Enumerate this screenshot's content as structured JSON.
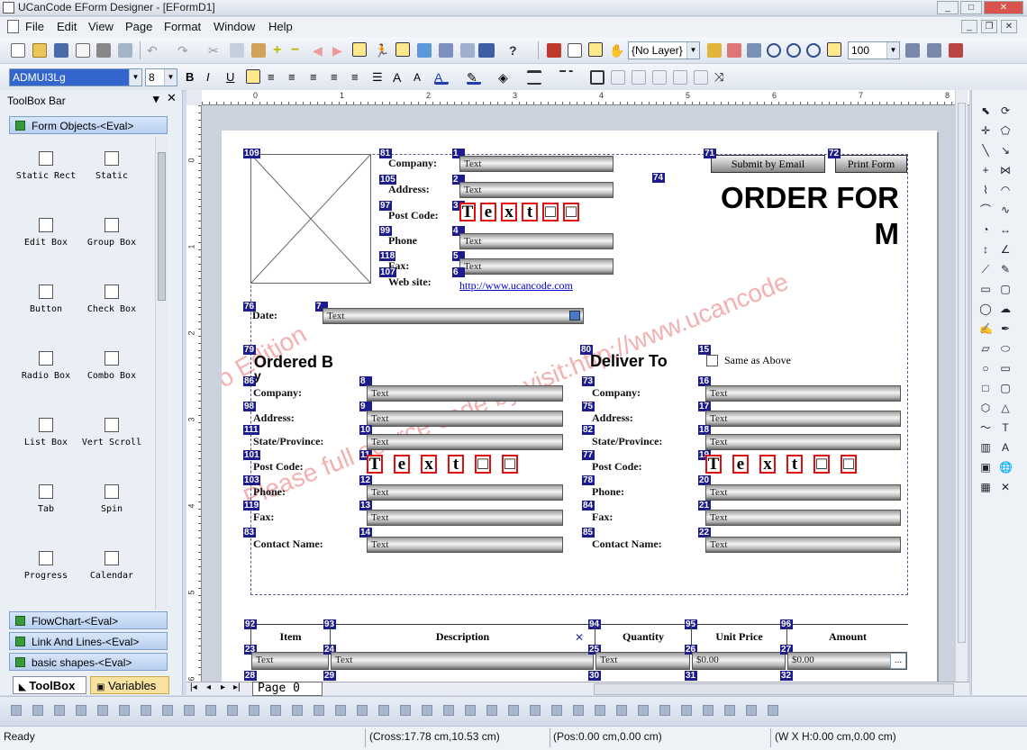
{
  "window": {
    "title": "UCanCode EForm Designer - [EFormD1]"
  },
  "menu": [
    "File",
    "Edit",
    "View",
    "Page",
    "Format",
    "Window",
    "Help"
  ],
  "toolbar": {
    "layer_combo": "{No Layer}",
    "zoom_value": "100"
  },
  "format_bar": {
    "font_name": "ADMUI3Lg",
    "font_size": "8"
  },
  "toolbox": {
    "title": "ToolBox Bar",
    "groups_top": [
      {
        "label": "Form Objects-<Eval>"
      }
    ],
    "tools": [
      {
        "label": "Static Rect",
        "icon": "static-rect-icon"
      },
      {
        "label": "Static",
        "icon": "static-text-icon"
      },
      {
        "label": "Edit Box",
        "icon": "edit-box-icon"
      },
      {
        "label": "Group Box",
        "icon": "group-box-icon"
      },
      {
        "label": "Button",
        "icon": "button-icon"
      },
      {
        "label": "Check Box",
        "icon": "check-box-icon"
      },
      {
        "label": "Radio Box",
        "icon": "radio-box-icon"
      },
      {
        "label": "Combo Box",
        "icon": "combo-box-icon"
      },
      {
        "label": "List Box",
        "icon": "list-box-icon"
      },
      {
        "label": "Vert Scroll",
        "icon": "vert-scroll-icon"
      },
      {
        "label": "Tab",
        "icon": "tab-icon"
      },
      {
        "label": "Spin",
        "icon": "spin-icon"
      },
      {
        "label": "Progress",
        "icon": "progress-icon"
      },
      {
        "label": "Calendar",
        "icon": "calendar-icon"
      }
    ],
    "groups_bottom": [
      {
        "label": "FlowChart-<Eval>"
      },
      {
        "label": "Link And Lines-<Eval>"
      },
      {
        "label": "basic shapes-<Eval>"
      }
    ],
    "tabs": [
      "ToolBox",
      "Variables"
    ]
  },
  "rulers": {
    "h": [
      "0",
      "1",
      "2",
      "3",
      "4",
      "5",
      "6",
      "7",
      "8"
    ],
    "v": [
      "0",
      "1",
      "2",
      "3",
      "4",
      "5",
      "6"
    ]
  },
  "form": {
    "title_line1": "ORDER FOR",
    "title_line2": "M",
    "submit_button": "Submit by Email",
    "print_button": "Print Form",
    "website": "http://www.ucancode.com",
    "watermark_1": "Demo Edition",
    "watermark_2": "Please full source code by visit:http://www.ucancode",
    "company_fields": [
      {
        "id": "81",
        "label": "Company:",
        "fid": "1",
        "value": "Text"
      },
      {
        "id": "105",
        "label": "Address:",
        "fid": "2",
        "value": "Text"
      },
      {
        "id": "97",
        "label": "Post Code:",
        "fid": "3",
        "value": ""
      },
      {
        "id": "99",
        "label": "Phone",
        "fid": "4",
        "value": "Text"
      },
      {
        "id": "118",
        "label": "Fax:",
        "fid": "5",
        "value": "Text"
      },
      {
        "id": "107",
        "label": "Web site:",
        "fid": "6",
        "value": ""
      }
    ],
    "comb_chars": [
      "T",
      "e",
      "x",
      "t",
      "□",
      "□"
    ],
    "date_label": "Date:",
    "date_value": "Text",
    "ordered_by": {
      "heading_1": "Ordered B",
      "heading_2": "y",
      "fields": [
        {
          "id": "86",
          "label": "Company:",
          "fid": "8",
          "value": "Text"
        },
        {
          "id": "98",
          "label": "Address:",
          "fid": "9",
          "value": "Text"
        },
        {
          "id": "111",
          "label": "State/Province:",
          "fid": "10",
          "value": "Text"
        },
        {
          "id": "101",
          "label": "Post Code:",
          "fid": "11",
          "value": ""
        },
        {
          "id": "103",
          "label": "Phone:",
          "fid": "12",
          "value": "Text"
        },
        {
          "id": "119",
          "label": "Fax:",
          "fid": "13",
          "value": "Text"
        },
        {
          "id": "83",
          "label": "Contact Name:",
          "fid": "14",
          "value": "Text"
        }
      ]
    },
    "deliver_to": {
      "heading": "Deliver To",
      "same_as_above": "Same as Above",
      "fields": [
        {
          "id": "73",
          "label": "Company:",
          "fid": "16",
          "value": "Text"
        },
        {
          "id": "75",
          "label": "Address:",
          "fid": "17",
          "value": "Text"
        },
        {
          "id": "82",
          "label": "State/Province:",
          "fid": "18",
          "value": "Text"
        },
        {
          "id": "77",
          "label": "Post Code:",
          "fid": "19",
          "value": ""
        },
        {
          "id": "78",
          "label": "Phone:",
          "fid": "20",
          "value": "Text"
        },
        {
          "id": "84",
          "label": "Fax:",
          "fid": "21",
          "value": "Text"
        },
        {
          "id": "85",
          "label": "Contact Name:",
          "fid": "22",
          "value": "Text"
        }
      ]
    },
    "table": {
      "headers": [
        {
          "id": "92",
          "label": "Item"
        },
        {
          "id": "93",
          "label": "Description"
        },
        {
          "id": "94",
          "label": "Quantity"
        },
        {
          "id": "95",
          "label": "Unit Price"
        },
        {
          "id": "96",
          "label": "Amount"
        }
      ],
      "row1": [
        {
          "id": "23",
          "value": "Text"
        },
        {
          "id": "24",
          "value": "Text"
        },
        {
          "id": "25",
          "value": "Text"
        },
        {
          "id": "26",
          "value": "$0.00"
        },
        {
          "id": "27",
          "value": "$0.00"
        }
      ],
      "row2_ids": [
        "28",
        "29",
        "30",
        "31",
        "32"
      ]
    },
    "misc_ids": {
      "image": "109",
      "date": "76",
      "date_field": "7",
      "ordered": "79",
      "deliver": "80",
      "same_check": "15",
      "submit": "71",
      "print": "72",
      "title": "74"
    }
  },
  "page_tab": "Page   0",
  "status": {
    "ready": "Ready",
    "cross": "(Cross:17.78 cm,10.53 cm)",
    "pos": "(Pos:0.00 cm,0.00 cm)",
    "size": "(W X H:0.00 cm,0.00 cm)"
  }
}
